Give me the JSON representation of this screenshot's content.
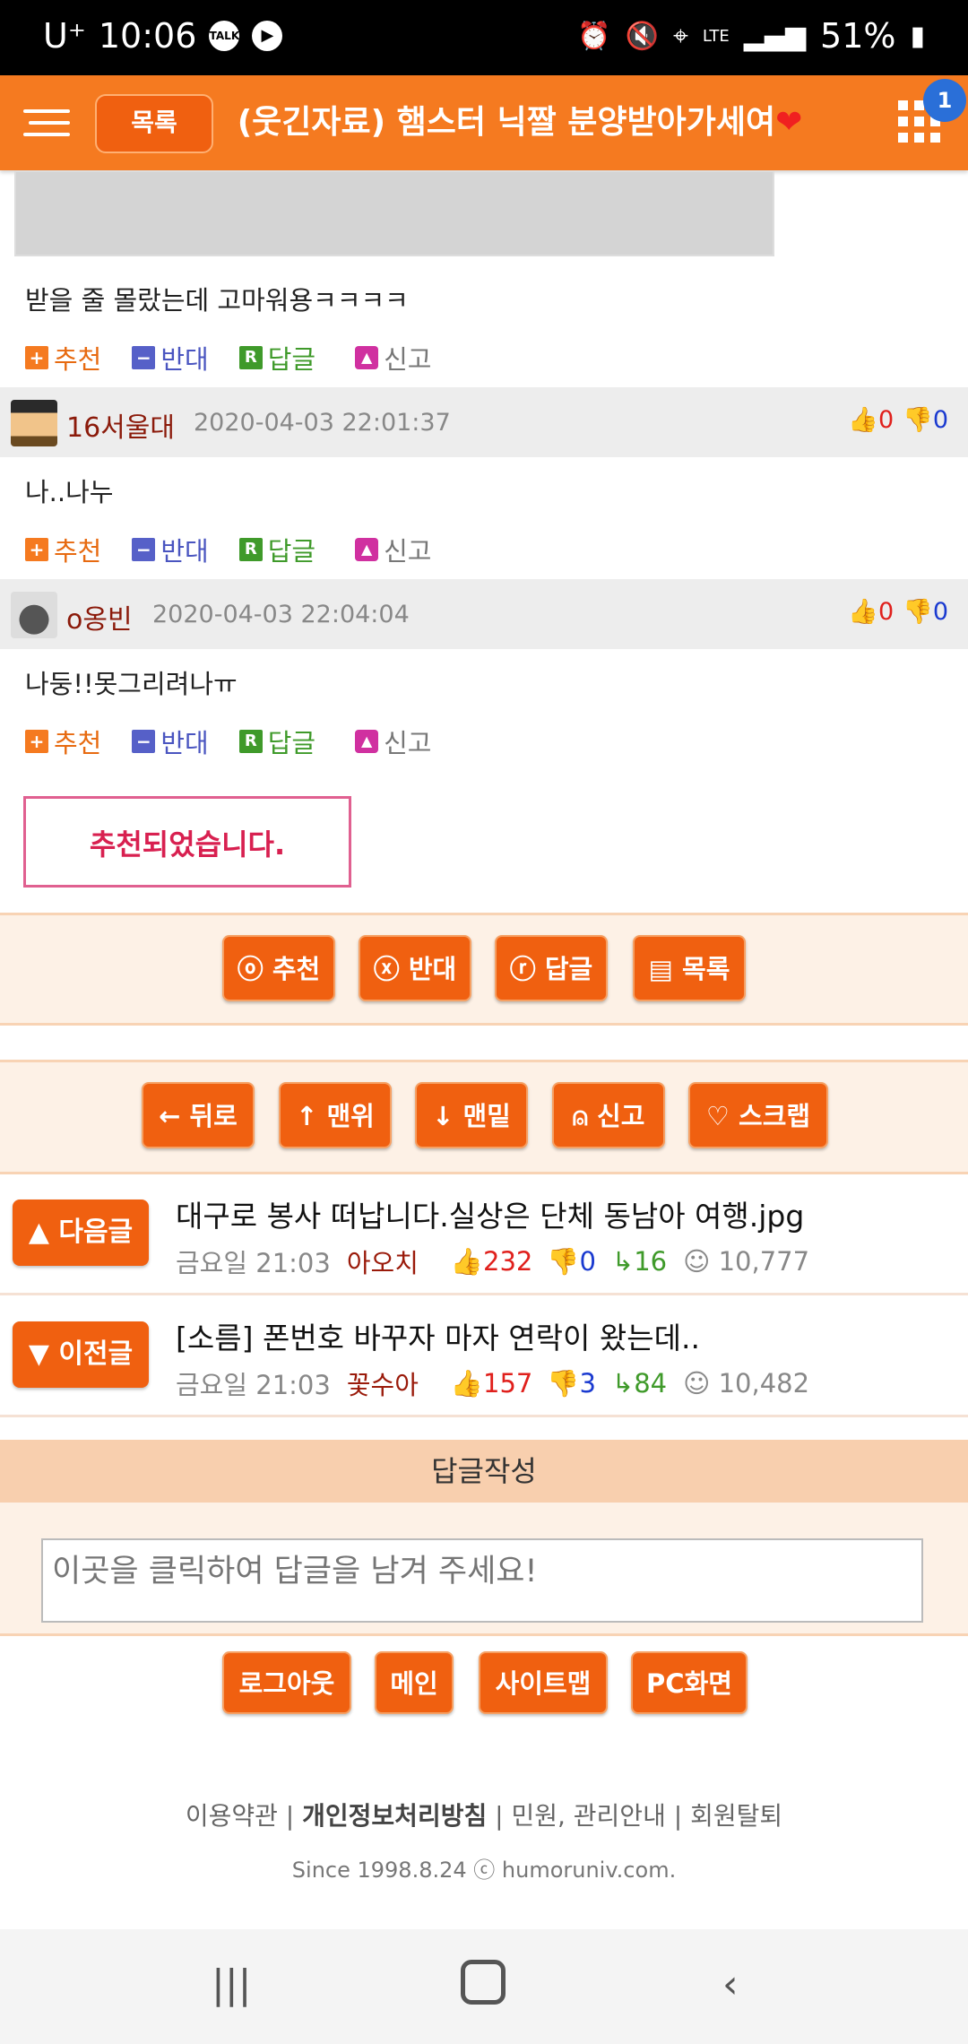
{
  "status_bar": {
    "carrier": "U⁺",
    "time": "10:06",
    "talk_icon_label": "TALK",
    "battery": "51%",
    "icons": [
      "talk-icon",
      "play-icon",
      "alarm-icon",
      "mute-icon",
      "location-icon",
      "lte-icon",
      "signal-icon",
      "battery-icon"
    ]
  },
  "header": {
    "list_label": "목록",
    "title": "(웃긴자료) 햄스터 닉짤 분양받아가세여",
    "badge": "1"
  },
  "comments": [
    {
      "body": "받을 줄 몰랐는데 고마워용ㅋㅋㅋㅋ"
    },
    {
      "nick": "16서울대",
      "time": "2020-04-03 22:01:37",
      "up": "0",
      "down": "0",
      "body": "나..나누"
    },
    {
      "nick": "o옹빈",
      "time": "2020-04-03 22:04:04",
      "up": "0",
      "down": "0",
      "body": "나둥!!못그리려나ㅠ"
    }
  ],
  "comment_actions": {
    "up": "추천",
    "down": "반대",
    "reply": "답글",
    "report": "신고",
    "up_icon": "+",
    "down_icon": "−",
    "reply_icon": "R"
  },
  "recommended_message": "추천되었습니다.",
  "post_buttons": {
    "up": "ⓞ 추천",
    "down": "ⓧ 반대",
    "reply": "ⓡ 답글",
    "list": "▤ 목록"
  },
  "nav_buttons": {
    "back": "← 뒤로",
    "top": "↑ 맨위",
    "bottom": "↓ 맨밑",
    "report": "⍝ 신고",
    "scrap": "♡ 스크랩"
  },
  "next_post": {
    "label": "▲ 다음글",
    "title": "대구로 봉사 떠납니다.실상은 단체 동남아 여행.jpg",
    "time": "금요일 21:03",
    "user": "아오치",
    "up": "232",
    "down": "0",
    "replies": "16",
    "views": "10,777"
  },
  "prev_post": {
    "label": "▼ 이전글",
    "title": "[소름] 폰번호 바꾸자 마자 연락이 왔는데..",
    "time": "금요일 21:03",
    "user": "꽃수아",
    "up": "157",
    "down": "3",
    "replies": "84",
    "views": "10,482"
  },
  "reply_section": {
    "header": "답글작성",
    "placeholder": "이곳을 클릭하여 답글을 남겨 주세요!"
  },
  "bottom_buttons": {
    "logout": "로그아웃",
    "main": "메인",
    "sitemap": "사이트맵",
    "pc": "PC화면"
  },
  "footer": {
    "terms": "이용약관",
    "privacy": "개인정보처리방침",
    "civil": "민원, 관리안내",
    "withdraw": "회원탈퇴",
    "since": "Since 1998.8.24 ⓒ humoruniv.com."
  },
  "colors": {
    "brand_orange": "#f57a20",
    "button_orange": "#f06010",
    "upvote_red": "#e0201c",
    "downvote_blue": "#1a3ad0"
  }
}
